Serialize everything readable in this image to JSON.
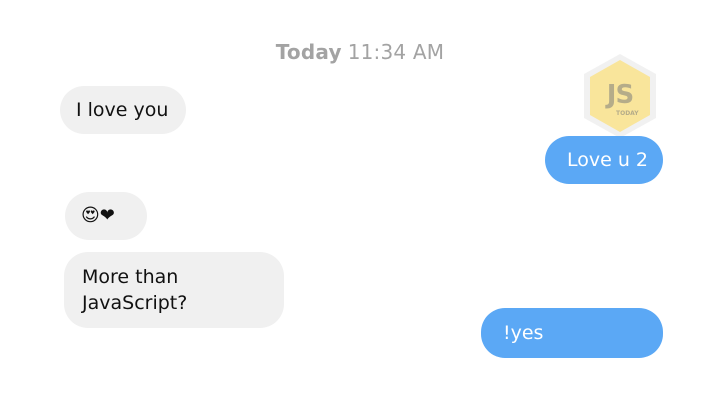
{
  "timestamp": {
    "day": "Today",
    "time": "11:34 AM"
  },
  "messages": [
    {
      "direction": "incoming",
      "text": "I love you"
    },
    {
      "direction": "outgoing",
      "text": "Love u 2"
    },
    {
      "direction": "incoming",
      "emoji": "😍",
      "heart": "❤"
    },
    {
      "direction": "incoming",
      "text": "More than JavaScript?"
    },
    {
      "direction": "outgoing",
      "text": "!yes"
    }
  ],
  "watermark": {
    "title": "JS",
    "subtitle": "TODAY",
    "color": "#f5d04a"
  },
  "colors": {
    "incoming_bubble": "#f0f0f0",
    "outgoing_bubble": "#5ba8f5",
    "timestamp": "#a3a3a3"
  }
}
